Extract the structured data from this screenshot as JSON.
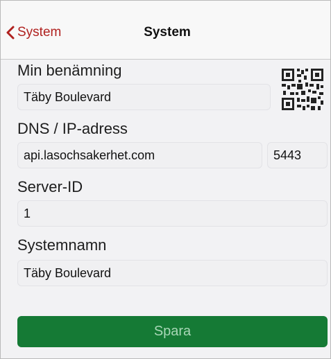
{
  "nav": {
    "back_label": "System",
    "title": "System"
  },
  "form": {
    "name_label": "Min benämning",
    "name_value": "Täby Boulevard",
    "dns_label": "DNS / IP-adress",
    "dns_value": "api.lasochsakerhet.com",
    "port_value": "5443",
    "server_id_label": "Server-ID",
    "server_id_value": "1",
    "system_name_label": "Systemnamn",
    "system_name_value": "Täby Boulevard"
  },
  "actions": {
    "save_label": "Spara"
  },
  "icons": {
    "back": "chevron-left-icon",
    "qr": "qr-code-icon"
  },
  "colors": {
    "accent": "#b0211f",
    "save_button": "#157a35",
    "save_text": "#a8d7b6"
  }
}
